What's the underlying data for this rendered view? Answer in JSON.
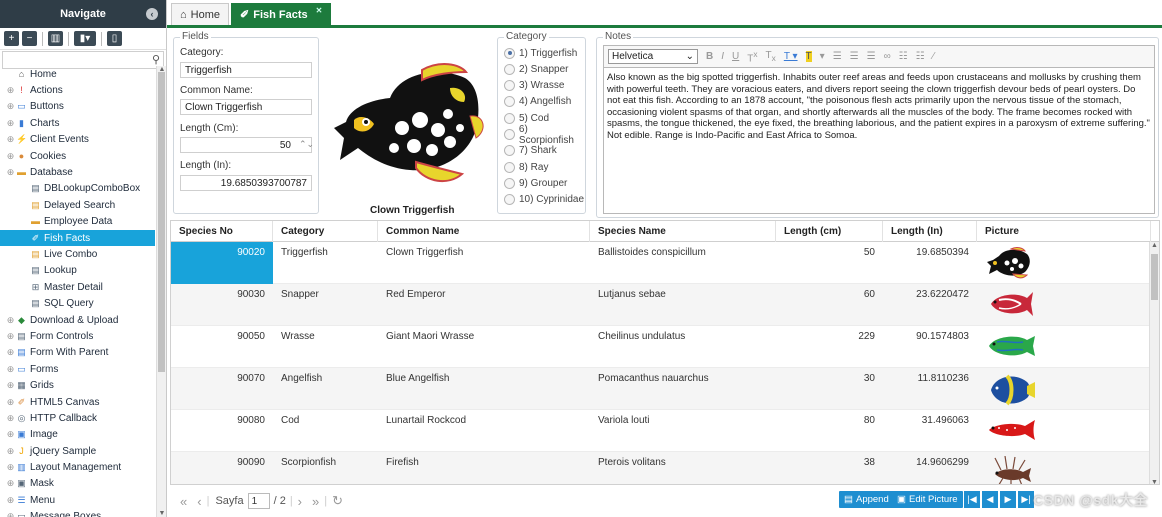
{
  "nav": {
    "title": "Navigate",
    "tree": [
      {
        "label": "Home",
        "icon": "home-icon",
        "glyph": "⌂",
        "color": "#555",
        "sub": false
      },
      {
        "label": "Actions",
        "icon": "alert-icon",
        "glyph": "!",
        "color": "#d33",
        "sub": false
      },
      {
        "label": "Buttons",
        "icon": "button-icon",
        "glyph": "▭",
        "color": "#3a7bd5",
        "sub": false
      },
      {
        "label": "Charts",
        "icon": "chart-icon",
        "glyph": "▮",
        "color": "#3a7bd5",
        "sub": false
      },
      {
        "label": "Client Events",
        "icon": "lightning-icon",
        "glyph": "⚡",
        "color": "#f0a500",
        "sub": false
      },
      {
        "label": "Cookies",
        "icon": "cookie-icon",
        "glyph": "●",
        "color": "#d98a3a",
        "sub": false
      },
      {
        "label": "Database",
        "icon": "database-icon",
        "glyph": "▬",
        "color": "#e0a030",
        "sub": false
      },
      {
        "label": "DBLookupComboBox",
        "icon": "combo-icon",
        "glyph": "▤",
        "color": "#567",
        "sub": true
      },
      {
        "label": "Delayed Search",
        "icon": "search-db-icon",
        "glyph": "▤",
        "color": "#e0a030",
        "sub": true
      },
      {
        "label": "Employee Data",
        "icon": "table-icon",
        "glyph": "▬",
        "color": "#e0a030",
        "sub": true
      },
      {
        "label": "Fish Facts",
        "icon": "fish-icon",
        "glyph": "✐",
        "color": "#fff",
        "sub": true,
        "selected": true
      },
      {
        "label": "Live Combo",
        "icon": "combo-icon",
        "glyph": "▤",
        "color": "#e0a030",
        "sub": true
      },
      {
        "label": "Lookup",
        "icon": "lookup-icon",
        "glyph": "▤",
        "color": "#567",
        "sub": true
      },
      {
        "label": "Master Detail",
        "icon": "master-detail-icon",
        "glyph": "⊞",
        "color": "#567",
        "sub": true
      },
      {
        "label": "SQL Query",
        "icon": "sql-icon",
        "glyph": "▤",
        "color": "#567",
        "sub": true
      },
      {
        "label": "Download & Upload",
        "icon": "download-icon",
        "glyph": "◆",
        "color": "#2a8a3a",
        "sub": false
      },
      {
        "label": "Form Controls",
        "icon": "form-icon",
        "glyph": "▤",
        "color": "#567",
        "sub": false
      },
      {
        "label": "Form With Parent",
        "icon": "form-parent-icon",
        "glyph": "▤",
        "color": "#3a7bd5",
        "sub": false
      },
      {
        "label": "Forms",
        "icon": "forms-icon",
        "glyph": "▭",
        "color": "#3a7bd5",
        "sub": false
      },
      {
        "label": "Grids",
        "icon": "grid-icon",
        "glyph": "▦",
        "color": "#567",
        "sub": false
      },
      {
        "label": "HTML5 Canvas",
        "icon": "canvas-icon",
        "glyph": "✐",
        "color": "#d98a3a",
        "sub": false
      },
      {
        "label": "HTTP Callback",
        "icon": "globe-icon",
        "glyph": "◎",
        "color": "#567",
        "sub": false
      },
      {
        "label": "Image",
        "icon": "image-icon",
        "glyph": "▣",
        "color": "#3a7bd5",
        "sub": false
      },
      {
        "label": "jQuery Sample",
        "icon": "jquery-icon",
        "glyph": "J",
        "color": "#f0a500",
        "sub": false
      },
      {
        "label": "Layout Management",
        "icon": "layout-icon",
        "glyph": "▥",
        "color": "#3a7bd5",
        "sub": false
      },
      {
        "label": "Mask",
        "icon": "mask-icon",
        "glyph": "▣",
        "color": "#567",
        "sub": false
      },
      {
        "label": "Menu",
        "icon": "menu-icon",
        "glyph": "☰",
        "color": "#3a7bd5",
        "sub": false
      },
      {
        "label": "Message Boxes",
        "icon": "message-icon",
        "glyph": "▭",
        "color": "#567",
        "sub": false
      }
    ]
  },
  "tabs": [
    {
      "label": "Home",
      "icon": "home-icon",
      "active": false
    },
    {
      "label": "Fish Facts",
      "icon": "fish-icon",
      "active": true
    }
  ],
  "fields": {
    "legend": "Fields",
    "category_label": "Category:",
    "category_value": "Triggerfish",
    "common_label": "Common Name:",
    "common_value": "Clown Triggerfish",
    "length_cm_label": "Length (Cm):",
    "length_cm_value": "50",
    "length_in_label": "Length (In):",
    "length_in_value": "19.6850393700787"
  },
  "picture_caption": "Clown Triggerfish",
  "category": {
    "legend": "Category",
    "options": [
      "1) Triggerfish",
      "2) Snapper",
      "3) Wrasse",
      "4) Angelfish",
      "5) Cod",
      "6) Scorpionfish",
      "7) Shark",
      "8) Ray",
      "9) Grouper",
      "10) Cyprinidae"
    ],
    "selected": "1) Triggerfish"
  },
  "notes": {
    "legend": "Notes",
    "font": "Helvetica",
    "text": "Also known as the big spotted triggerfish. Inhabits outer reef areas and feeds upon crustaceans and mollusks by crushing them with powerful teeth. They are voracious eaters, and divers report seeing the clown triggerfish devour beds of pearl oysters. Do not eat this fish. According to an 1878 account, \"the poisonous flesh acts primarily upon the nervous tissue of the stomach, occasioning violent spasms of that organ, and shortly afterwards all the muscles of the body. The frame becomes rocked with spasms, the tongue thickened, the eye fixed, the breathing laborious, and the patient expires in a paroxysm of extreme suffering.\" Not edible. Range is Indo-Pacific and East Africa to Somoa."
  },
  "grid": {
    "columns": [
      "Species No",
      "Category",
      "Common Name",
      "Species Name",
      "Length (cm)",
      "Length (In)",
      "Picture"
    ],
    "rows": [
      {
        "no": "90020",
        "cat": "Triggerfish",
        "common": "Clown Triggerfish",
        "species": "Ballistoides conspicillum",
        "cm": "50",
        "in": "19.6850394",
        "fish": "triggerfish"
      },
      {
        "no": "90030",
        "cat": "Snapper",
        "common": "Red Emperor",
        "species": "Lutjanus sebae",
        "cm": "60",
        "in": "23.6220472",
        "fish": "snapper"
      },
      {
        "no": "90050",
        "cat": "Wrasse",
        "common": "Giant Maori Wrasse",
        "species": "Cheilinus undulatus",
        "cm": "229",
        "in": "90.1574803",
        "fish": "wrasse"
      },
      {
        "no": "90070",
        "cat": "Angelfish",
        "common": "Blue Angelfish",
        "species": "Pomacanthus nauarchus",
        "cm": "30",
        "in": "11.8110236",
        "fish": "angelfish"
      },
      {
        "no": "90080",
        "cat": "Cod",
        "common": "Lunartail Rockcod",
        "species": "Variola louti",
        "cm": "80",
        "in": "31.496063",
        "fish": "cod"
      },
      {
        "no": "90090",
        "cat": "Scorpionfish",
        "common": "Firefish",
        "species": "Pterois volitans",
        "cm": "38",
        "in": "14.9606299",
        "fish": "scorpion"
      }
    ]
  },
  "pager": {
    "page_label": "Sayfa",
    "page_value": "1",
    "page_total": "/ 2",
    "append": "Append",
    "edit_picture": "Edit Picture"
  },
  "watermark": "CSDN @sdk大全"
}
